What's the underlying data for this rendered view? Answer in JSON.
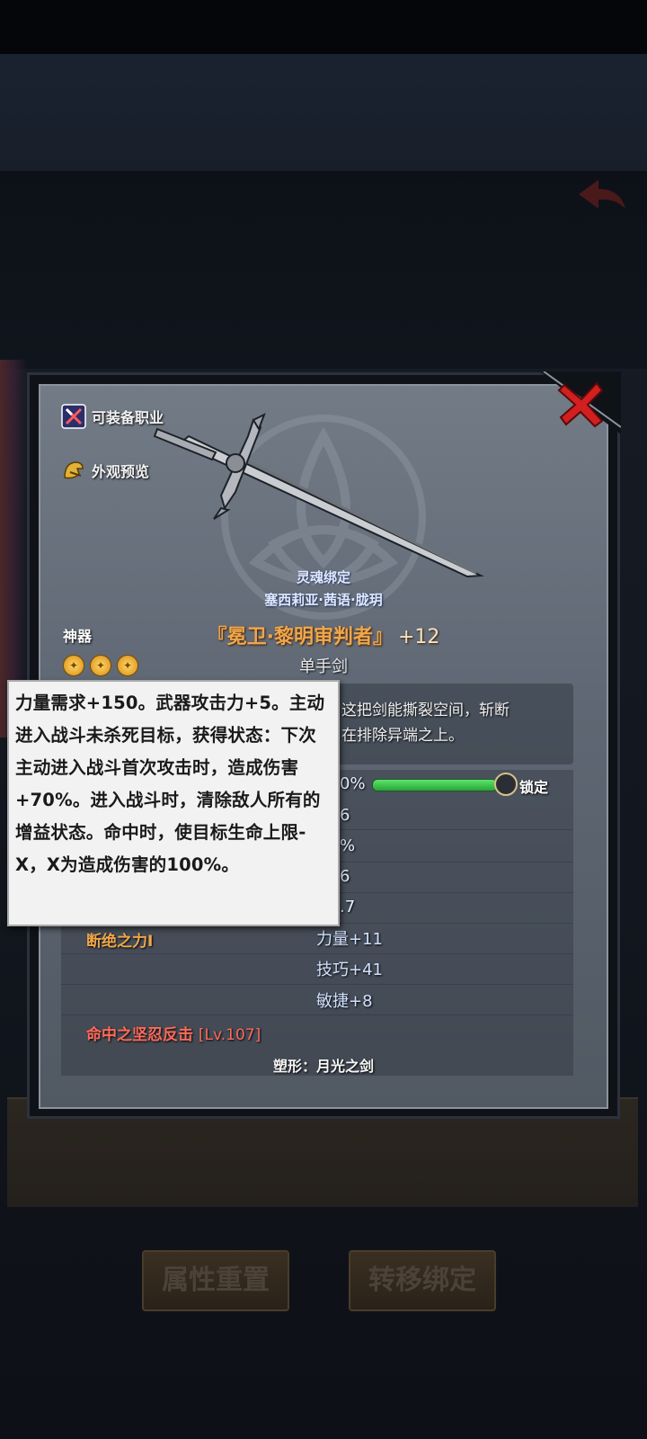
{
  "background": {
    "buttons": [
      "属性重置",
      "转移绑定"
    ]
  },
  "item": {
    "side_actions": [
      {
        "label": "可装备职业",
        "icon": "crossed-weapons-icon"
      },
      {
        "label": "外观预览",
        "icon": "appearance-preview-icon"
      }
    ],
    "soul_bound": "灵魂绑定",
    "owner": "塞西莉亚·茜语·胧玥",
    "rarity_label": "神器",
    "name": "『冕卫·黎明审判者』",
    "enhance": "+12",
    "weapon_type": "单手剑",
    "stars": 3,
    "description_visible": "这把剑能撕裂空间，斩断\n在排除异端之上。",
    "stats_visible": [
      "0%",
      "6",
      "%",
      "6",
      ".7"
    ],
    "lock_label": "锁定",
    "skill_1": "断绝之力I",
    "attributes": [
      "力量+11",
      "技巧+41",
      "敏捷+8"
    ],
    "skill_2_name": "命中之坚忍反击",
    "skill_2_level": "[Lv.107]",
    "shape": "塑形：月光之剑",
    "accent_colors": {
      "name": "#f0a64a",
      "red_skill": "#ff6a5a",
      "bar": "#3cc84a"
    }
  },
  "tooltip": {
    "text": "力量需求+150。武器攻击力+5。主动进入战斗未杀死目标，获得状态：下次主动进入战斗首次攻击时，造成伤害+70%。进入战斗时，清除敌人所有的增益状态。命中时，使目标生命上限-X，X为造成伤害的100%。"
  }
}
